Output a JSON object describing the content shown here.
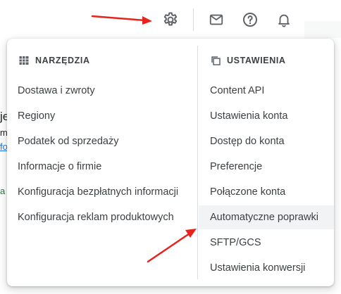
{
  "toolbar": {
    "icons": [
      {
        "name": "settings-gear-icon"
      },
      {
        "name": "mail-icon"
      },
      {
        "name": "help-icon"
      },
      {
        "name": "notifications-bell-icon"
      }
    ]
  },
  "background_fragments": [
    "je",
    "m",
    "fo",
    "a"
  ],
  "menu": {
    "tools": {
      "icon": "grid-icon",
      "heading": "NARZĘDZIA",
      "items": [
        {
          "label": "Dostawa i zwroty"
        },
        {
          "label": "Regiony"
        },
        {
          "label": "Podatek od sprzedaży"
        },
        {
          "label": "Informacje o firmie"
        },
        {
          "label": "Konfiguracja bezpłatnych informacji"
        },
        {
          "label": "Konfiguracja reklam produktowych"
        }
      ]
    },
    "settings": {
      "icon": "copy-settings-icon",
      "heading": "USTAWIENIA",
      "items": [
        {
          "label": "Content API"
        },
        {
          "label": "Ustawienia konta"
        },
        {
          "label": "Dostęp do konta"
        },
        {
          "label": "Preferencje"
        },
        {
          "label": "Połączone konta"
        },
        {
          "label": "Automatyczne poprawki"
        },
        {
          "label": "SFTP/GCS"
        },
        {
          "label": "Ustawienia konwersji"
        }
      ],
      "highlighted_index": 5
    }
  },
  "colors": {
    "annotation_arrow": "#e8231c",
    "highlight_bg": "#f1f3f4",
    "text": "#3c4043"
  }
}
